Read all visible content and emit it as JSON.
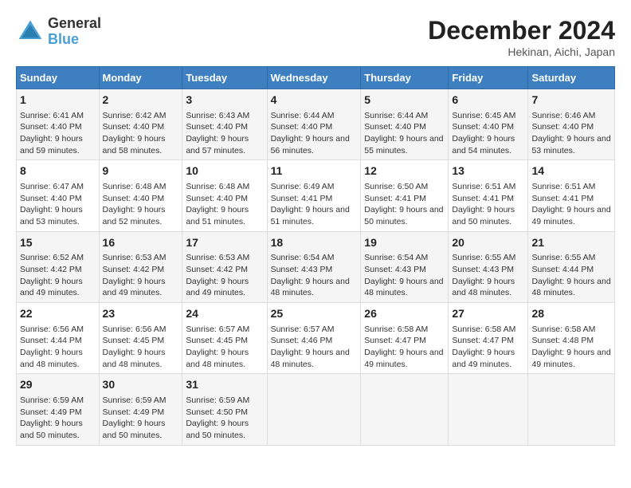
{
  "header": {
    "logo_line1": "General",
    "logo_line2": "Blue",
    "title": "December 2024",
    "subtitle": "Hekinan, Aichi, Japan"
  },
  "columns": [
    "Sunday",
    "Monday",
    "Tuesday",
    "Wednesday",
    "Thursday",
    "Friday",
    "Saturday"
  ],
  "weeks": [
    [
      {
        "day": "1",
        "sunrise": "Sunrise: 6:41 AM",
        "sunset": "Sunset: 4:40 PM",
        "daylight": "Daylight: 9 hours and 59 minutes."
      },
      {
        "day": "2",
        "sunrise": "Sunrise: 6:42 AM",
        "sunset": "Sunset: 4:40 PM",
        "daylight": "Daylight: 9 hours and 58 minutes."
      },
      {
        "day": "3",
        "sunrise": "Sunrise: 6:43 AM",
        "sunset": "Sunset: 4:40 PM",
        "daylight": "Daylight: 9 hours and 57 minutes."
      },
      {
        "day": "4",
        "sunrise": "Sunrise: 6:44 AM",
        "sunset": "Sunset: 4:40 PM",
        "daylight": "Daylight: 9 hours and 56 minutes."
      },
      {
        "day": "5",
        "sunrise": "Sunrise: 6:44 AM",
        "sunset": "Sunset: 4:40 PM",
        "daylight": "Daylight: 9 hours and 55 minutes."
      },
      {
        "day": "6",
        "sunrise": "Sunrise: 6:45 AM",
        "sunset": "Sunset: 4:40 PM",
        "daylight": "Daylight: 9 hours and 54 minutes."
      },
      {
        "day": "7",
        "sunrise": "Sunrise: 6:46 AM",
        "sunset": "Sunset: 4:40 PM",
        "daylight": "Daylight: 9 hours and 53 minutes."
      }
    ],
    [
      {
        "day": "8",
        "sunrise": "Sunrise: 6:47 AM",
        "sunset": "Sunset: 4:40 PM",
        "daylight": "Daylight: 9 hours and 53 minutes."
      },
      {
        "day": "9",
        "sunrise": "Sunrise: 6:48 AM",
        "sunset": "Sunset: 4:40 PM",
        "daylight": "Daylight: 9 hours and 52 minutes."
      },
      {
        "day": "10",
        "sunrise": "Sunrise: 6:48 AM",
        "sunset": "Sunset: 4:40 PM",
        "daylight": "Daylight: 9 hours and 51 minutes."
      },
      {
        "day": "11",
        "sunrise": "Sunrise: 6:49 AM",
        "sunset": "Sunset: 4:41 PM",
        "daylight": "Daylight: 9 hours and 51 minutes."
      },
      {
        "day": "12",
        "sunrise": "Sunrise: 6:50 AM",
        "sunset": "Sunset: 4:41 PM",
        "daylight": "Daylight: 9 hours and 50 minutes."
      },
      {
        "day": "13",
        "sunrise": "Sunrise: 6:51 AM",
        "sunset": "Sunset: 4:41 PM",
        "daylight": "Daylight: 9 hours and 50 minutes."
      },
      {
        "day": "14",
        "sunrise": "Sunrise: 6:51 AM",
        "sunset": "Sunset: 4:41 PM",
        "daylight": "Daylight: 9 hours and 49 minutes."
      }
    ],
    [
      {
        "day": "15",
        "sunrise": "Sunrise: 6:52 AM",
        "sunset": "Sunset: 4:42 PM",
        "daylight": "Daylight: 9 hours and 49 minutes."
      },
      {
        "day": "16",
        "sunrise": "Sunrise: 6:53 AM",
        "sunset": "Sunset: 4:42 PM",
        "daylight": "Daylight: 9 hours and 49 minutes."
      },
      {
        "day": "17",
        "sunrise": "Sunrise: 6:53 AM",
        "sunset": "Sunset: 4:42 PM",
        "daylight": "Daylight: 9 hours and 49 minutes."
      },
      {
        "day": "18",
        "sunrise": "Sunrise: 6:54 AM",
        "sunset": "Sunset: 4:43 PM",
        "daylight": "Daylight: 9 hours and 48 minutes."
      },
      {
        "day": "19",
        "sunrise": "Sunrise: 6:54 AM",
        "sunset": "Sunset: 4:43 PM",
        "daylight": "Daylight: 9 hours and 48 minutes."
      },
      {
        "day": "20",
        "sunrise": "Sunrise: 6:55 AM",
        "sunset": "Sunset: 4:43 PM",
        "daylight": "Daylight: 9 hours and 48 minutes."
      },
      {
        "day": "21",
        "sunrise": "Sunrise: 6:55 AM",
        "sunset": "Sunset: 4:44 PM",
        "daylight": "Daylight: 9 hours and 48 minutes."
      }
    ],
    [
      {
        "day": "22",
        "sunrise": "Sunrise: 6:56 AM",
        "sunset": "Sunset: 4:44 PM",
        "daylight": "Daylight: 9 hours and 48 minutes."
      },
      {
        "day": "23",
        "sunrise": "Sunrise: 6:56 AM",
        "sunset": "Sunset: 4:45 PM",
        "daylight": "Daylight: 9 hours and 48 minutes."
      },
      {
        "day": "24",
        "sunrise": "Sunrise: 6:57 AM",
        "sunset": "Sunset: 4:45 PM",
        "daylight": "Daylight: 9 hours and 48 minutes."
      },
      {
        "day": "25",
        "sunrise": "Sunrise: 6:57 AM",
        "sunset": "Sunset: 4:46 PM",
        "daylight": "Daylight: 9 hours and 48 minutes."
      },
      {
        "day": "26",
        "sunrise": "Sunrise: 6:58 AM",
        "sunset": "Sunset: 4:47 PM",
        "daylight": "Daylight: 9 hours and 49 minutes."
      },
      {
        "day": "27",
        "sunrise": "Sunrise: 6:58 AM",
        "sunset": "Sunset: 4:47 PM",
        "daylight": "Daylight: 9 hours and 49 minutes."
      },
      {
        "day": "28",
        "sunrise": "Sunrise: 6:58 AM",
        "sunset": "Sunset: 4:48 PM",
        "daylight": "Daylight: 9 hours and 49 minutes."
      }
    ],
    [
      {
        "day": "29",
        "sunrise": "Sunrise: 6:59 AM",
        "sunset": "Sunset: 4:49 PM",
        "daylight": "Daylight: 9 hours and 50 minutes."
      },
      {
        "day": "30",
        "sunrise": "Sunrise: 6:59 AM",
        "sunset": "Sunset: 4:49 PM",
        "daylight": "Daylight: 9 hours and 50 minutes."
      },
      {
        "day": "31",
        "sunrise": "Sunrise: 6:59 AM",
        "sunset": "Sunset: 4:50 PM",
        "daylight": "Daylight: 9 hours and 50 minutes."
      },
      null,
      null,
      null,
      null
    ]
  ]
}
